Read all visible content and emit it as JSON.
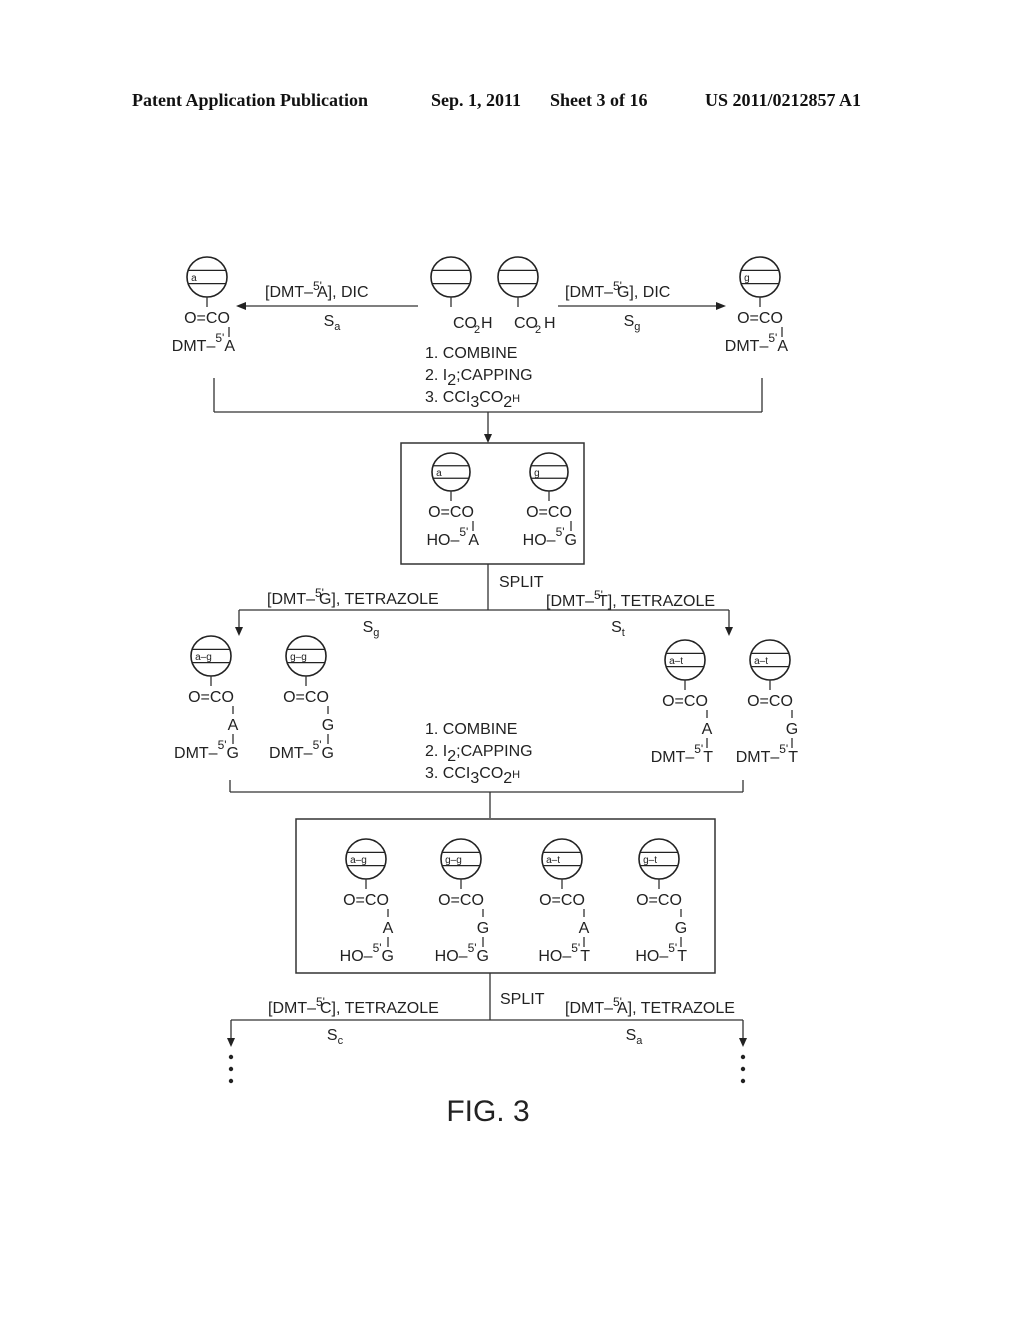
{
  "header": {
    "publication": "Patent Application Publication",
    "date": "Sep. 1, 2011",
    "sheet": "Sheet 3 of 16",
    "number": "US 2011/0212857 A1"
  },
  "figure": {
    "caption": "FIG. 3",
    "stage1": {
      "start_beads": [
        {
          "tag": "",
          "group": "CO2H"
        },
        {
          "tag": "",
          "group": "CO2H"
        }
      ],
      "left_reaction": {
        "reagent": "[DMT-5'A], DIC",
        "reagent_pre": "[DMT–",
        "sup": "5'",
        "base": "A",
        "reagent_post": "], DIC",
        "subset": "S",
        "subset_sub": "a"
      },
      "right_reaction": {
        "reagent": "[DMT-5'G], DIC",
        "reagent_pre": "[DMT–",
        "sup": "5'",
        "base": "G",
        "reagent_post": "], DIC",
        "subset": "S",
        "subset_sub": "g"
      },
      "left_product": {
        "tag": "a",
        "linker": "O=CO",
        "prefix": "DMT–",
        "sup": "5'",
        "base": "A"
      },
      "right_product": {
        "tag": "g",
        "linker": "O=CO",
        "prefix": "DMT–",
        "sup": "5'",
        "base": "A"
      },
      "steps": [
        {
          "num": "1.",
          "text": "COMBINE"
        },
        {
          "num": "2.",
          "pre": "I",
          "sub": "2",
          "post": ";CAPPING"
        },
        {
          "num": "3.",
          "pre": "CCI",
          "sub": "3",
          "mid": "CO",
          "sub2": "2",
          "post": "H"
        }
      ]
    },
    "box1": {
      "items": [
        {
          "tag": "a",
          "linker": "O=CO",
          "prefix": "HO–",
          "sup": "5'",
          "base": "A"
        },
        {
          "tag": "g",
          "linker": "O=CO",
          "prefix": "HO–",
          "sup": "5'",
          "base": "G"
        }
      ]
    },
    "stage2": {
      "split_label": "SPLIT",
      "left_reaction": {
        "reagent_pre": "[DMT–",
        "sup": "5'",
        "base": "G",
        "reagent_post": "], TETRAZOLE",
        "subset": "S",
        "subset_sub": "g"
      },
      "right_reaction": {
        "reagent_pre": "[DMT–",
        "sup": "5'",
        "base": "T",
        "reagent_post": "], TETRAZOLE",
        "subset": "S",
        "subset_sub": "t"
      },
      "products": [
        {
          "tag": "a–g",
          "linker": "O=CO",
          "mid": "A",
          "prefix": "DMT–",
          "sup": "5'",
          "base": "G"
        },
        {
          "tag": "g–g",
          "linker": "O=CO",
          "mid": "G",
          "prefix": "DMT–",
          "sup": "5'",
          "base": "G"
        },
        {
          "tag": "a–t",
          "linker": "O=CO",
          "mid": "A",
          "prefix": "DMT–",
          "sup": "5'",
          "base": "T"
        },
        {
          "tag": "a–t",
          "linker": "O=CO",
          "mid": "G",
          "prefix": "DMT–",
          "sup": "5'",
          "base": "T"
        }
      ],
      "steps": [
        {
          "num": "1.",
          "text": "COMBINE"
        },
        {
          "num": "2.",
          "pre": "I",
          "sub": "2",
          "post": ";CAPPING"
        },
        {
          "num": "3.",
          "pre": "CCI",
          "sub": "3",
          "mid": "CO",
          "sub2": "2",
          "post": "H"
        }
      ]
    },
    "box2": {
      "items": [
        {
          "tag": "a–g",
          "linker": "O=CO",
          "mid": "A",
          "prefix": "HO–",
          "sup": "5'",
          "base": "G"
        },
        {
          "tag": "g–g",
          "linker": "O=CO",
          "mid": "G",
          "prefix": "HO–",
          "sup": "5'",
          "base": "G"
        },
        {
          "tag": "a–t",
          "linker": "O=CO",
          "mid": "A",
          "prefix": "HO–",
          "sup": "5'",
          "base": "T"
        },
        {
          "tag": "g–t",
          "linker": "O=CO",
          "mid": "G",
          "prefix": "HO–",
          "sup": "5'",
          "base": "T"
        }
      ]
    },
    "stage3": {
      "split_label": "SPLIT",
      "left_reaction": {
        "reagent_pre": "[DMT–",
        "sup": "5'",
        "base": "C",
        "reagent_post": "], TETRAZOLE",
        "subset": "S",
        "subset_sub": "c"
      },
      "right_reaction": {
        "reagent_pre": "[DMT–",
        "sup": "5'",
        "base": "A",
        "reagent_post": "], TETRAZOLE",
        "subset": "S",
        "subset_sub": "a"
      },
      "continuation": "⋮"
    }
  }
}
